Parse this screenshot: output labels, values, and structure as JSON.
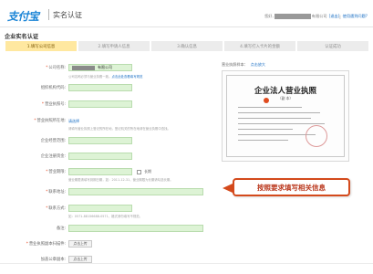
{
  "header": {
    "logo_text": "支付宝",
    "brand": "实名认证",
    "welcome_prefix": "您好,",
    "welcome_suffix": "有限公司",
    "logout_link": "[退出]",
    "help_link": "使用遇到问题?"
  },
  "page_title": "企业实名认证",
  "steps": [
    {
      "label": "1.填写公司信息",
      "active": true
    },
    {
      "label": "2.填写申请人信息",
      "active": false
    },
    {
      "label": "3.确认信息",
      "active": false
    },
    {
      "label": "4.填写打入卡片的金额",
      "active": false
    },
    {
      "label": "认证成功",
      "active": false
    }
  ],
  "form": {
    "company_name": {
      "label": "公司名称:",
      "value_suffix": "有限公司"
    },
    "company_hint": "公司名称必须与营业执照一致。点击此处查看填写规范",
    "company_hint_link": "点击此处查看填写规范",
    "org_code": {
      "label": "组织机构代码:"
    },
    "license_no": {
      "label": "营业执照号:"
    },
    "license_location": {
      "label": "营业执照所在地:",
      "link": "请选择"
    },
    "location_hint": "请填写营业执照上登记的所在地，登记机关的所在地请在营业执照中查找。",
    "business_scope": {
      "label": "企业经营范围:"
    },
    "registered_capital": {
      "label": "企业注册资金:"
    },
    "license_expiry": {
      "label": "营业期限:",
      "checkbox_label": "长期"
    },
    "expiry_hint": "营业期限请填写到期日期，如：2011-12-31，营业期限为长期请勾选长期。",
    "contact_address": {
      "label": "联系地址:"
    },
    "contact_phone": {
      "label": "联系方式:"
    },
    "phone_hint": "如：0571-88156688-0571，格式请勿填写不规范。",
    "remark": {
      "label": "备注:"
    },
    "license_upload": {
      "label": "营业执照副本扫描件:",
      "button": "点击上传"
    },
    "stamp_upload": {
      "label": "加盖公章副本:",
      "button": "点击上传"
    }
  },
  "sample": {
    "head": "营业执照样本：",
    "link": "点击放大",
    "title": "企业法人营业执照",
    "subtitle": "（副 本）"
  },
  "callout": "按照要求填写相关信息",
  "colors": {
    "accent": "#1a6fc4",
    "field_green": "#ddf3d5",
    "step_active": "#ffe8a0",
    "callout_red": "#d44a1c"
  }
}
